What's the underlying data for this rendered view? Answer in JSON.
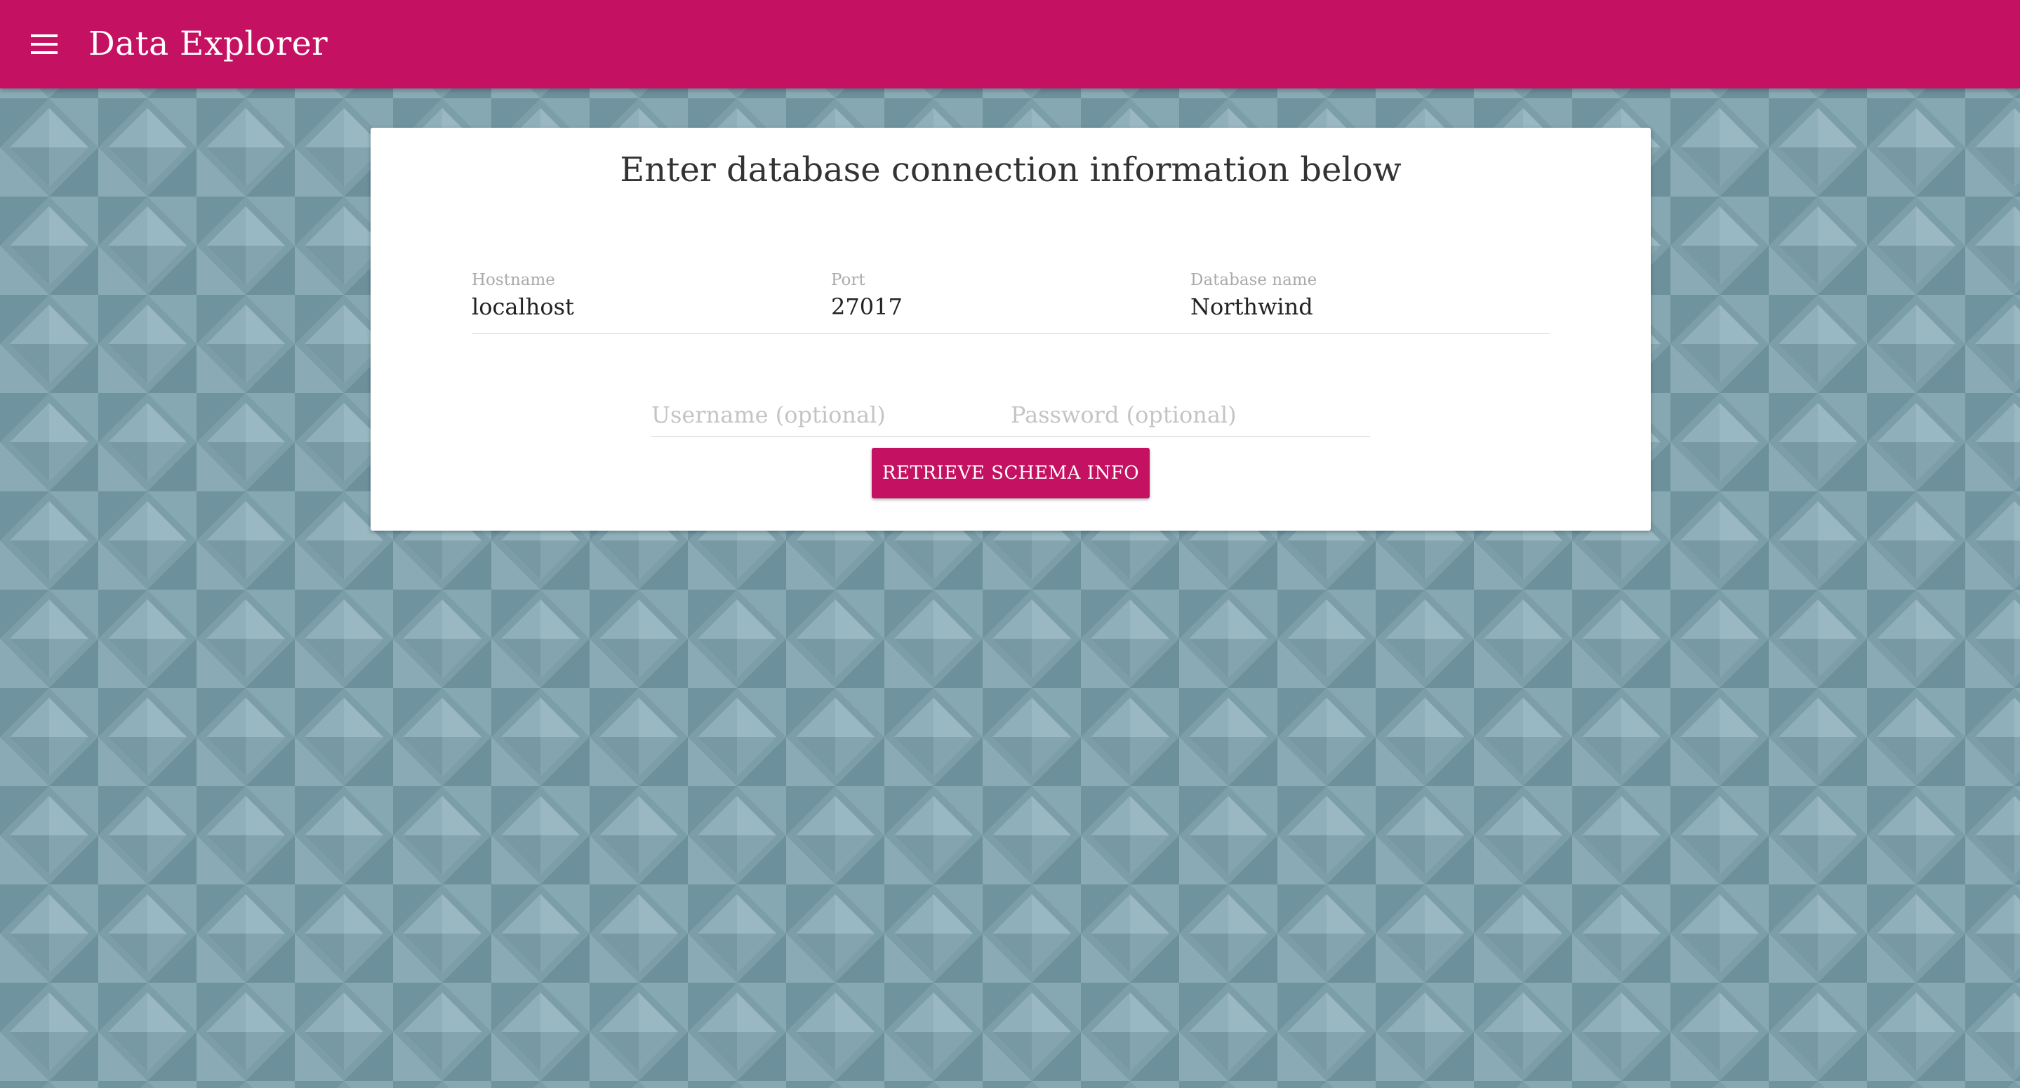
{
  "colors": {
    "primary": "#c51162",
    "background": "#7b9ea9",
    "card": "#ffffff"
  },
  "app_bar": {
    "menu_icon": "hamburger-menu-icon",
    "title": "Data Explorer"
  },
  "connection_form": {
    "heading": "Enter database connection information below",
    "hostname": {
      "label": "Hostname",
      "value": "localhost"
    },
    "port": {
      "label": "Port",
      "value": "27017"
    },
    "database_name": {
      "label": "Database name",
      "value": "Northwind"
    },
    "username": {
      "placeholder": "Username (optional)",
      "value": ""
    },
    "password": {
      "placeholder": "Password (optional)",
      "value": ""
    },
    "submit_label": "RETRIEVE SCHEMA INFO"
  }
}
